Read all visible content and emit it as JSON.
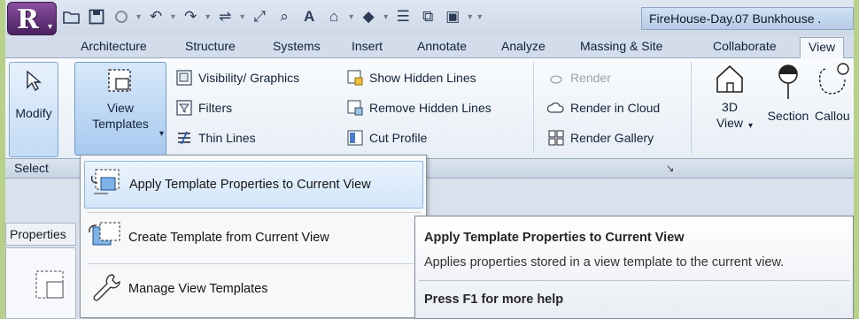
{
  "title_bar": {
    "app_letter": "R",
    "document_title": "FireHouse-Day.07 Bunkhouse ."
  },
  "tabs": [
    {
      "label": "Architecture",
      "active": false
    },
    {
      "label": "Structure",
      "active": false
    },
    {
      "label": "Systems",
      "active": false
    },
    {
      "label": "Insert",
      "active": false
    },
    {
      "label": "Annotate",
      "active": false
    },
    {
      "label": "Analyze",
      "active": false
    },
    {
      "label": "Massing & Site",
      "active": false
    },
    {
      "label": "Collaborate",
      "active": false
    },
    {
      "label": "View",
      "active": true
    }
  ],
  "ribbon": {
    "modify": "Modify",
    "view_templates_line1": "View",
    "view_templates_line2": "Templates",
    "graphics": {
      "visibility": "Visibility/ Graphics",
      "filters": "Filters",
      "thin_lines": "Thin Lines",
      "show_hidden": "Show Hidden Lines",
      "remove_hidden": "Remove Hidden Lines",
      "cut_profile": "Cut Profile",
      "render": "Render",
      "render_cloud": "Render in Cloud",
      "render_gallery": "Render Gallery"
    },
    "create": {
      "view_3d_line1": "3D",
      "view_3d_line2": "View",
      "section": "Section",
      "callout": "Callou"
    },
    "panel_select": "Select"
  },
  "properties_tab": "Properties",
  "menu": {
    "apply": "Apply Template Properties to Current View",
    "create": "Create Template from Current View",
    "manage": "Manage View Templates"
  },
  "tooltip": {
    "title": "Apply Template Properties to Current View",
    "description": "Applies properties stored in a view template to the current view.",
    "help": "Press F1 for more help"
  },
  "colors": {
    "outer_border": "#b7d08a",
    "ribbon_highlight": "#a8c9ee",
    "app_button": "#6a3480"
  }
}
